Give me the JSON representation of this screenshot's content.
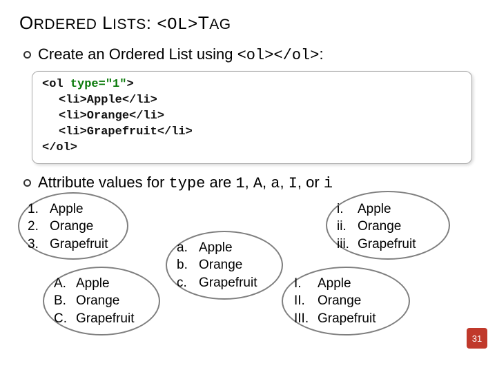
{
  "title": {
    "prefix": "O",
    "rdered": "RDERED",
    "l": " L",
    "ists": "ISTS",
    "colon": ": ",
    "lt": "<OL>",
    "suffix": "T",
    "ag": "AG"
  },
  "bullet1": {
    "t1": "Create an Ordered List using ",
    "code": "<ol></ol>",
    "t2": ":"
  },
  "code": {
    "l1a": "<ol ",
    "l1b": "type=\"1\"",
    "l1c": ">",
    "l2": "<li>Apple</li>",
    "l3": "<li>Orange</li>",
    "l4": "<li>Grapefruit</li>",
    "l5": "</ol>"
  },
  "bullet2": {
    "t1": "Attribute values for ",
    "c1": "type",
    "t2": " are ",
    "c2": "1",
    "t3": ", ",
    "c3": "A",
    "t4": ", ",
    "c4": "a",
    "t5": ", ",
    "c5": "I",
    "t6": ", or ",
    "c6": "i"
  },
  "fruits": [
    "Apple",
    "Orange",
    "Grapefruit"
  ],
  "markers": {
    "decimal": [
      "1.",
      "2.",
      "3."
    ],
    "upperAlpha": [
      "A.",
      "B.",
      "C."
    ],
    "lowerAlpha": [
      "a.",
      "b.",
      "c."
    ],
    "lowerRoman": [
      "i.",
      "ii.",
      "iii."
    ],
    "upperRoman": [
      "I.",
      "II.",
      "III."
    ]
  },
  "pageNumber": "31"
}
